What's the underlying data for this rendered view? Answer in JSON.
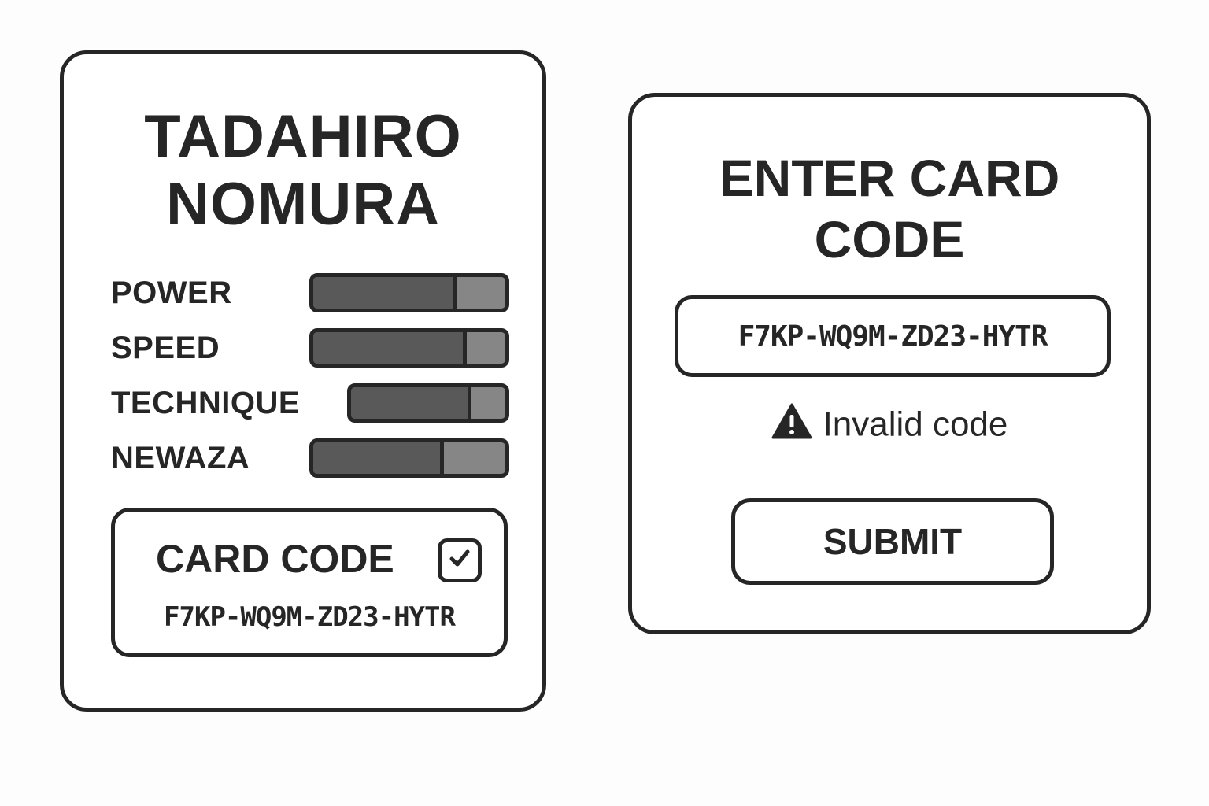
{
  "player_card": {
    "name_line1": "TADAHIRO",
    "name_line2": "NOMURA",
    "stats": [
      {
        "label": "POWER",
        "level": 0.75
      },
      {
        "label": "SPEED",
        "level": 0.8
      },
      {
        "label": "TECHNIQUE",
        "level": 0.78
      },
      {
        "label": "NEWAZA",
        "level": 0.68
      }
    ],
    "code_box": {
      "title": "CARD CODE",
      "value": "F7KP-WQ9M-ZD23-HYTR",
      "icon": "checkbox-checked-icon"
    }
  },
  "entry_dialog": {
    "title_line1": "ENTER CARD",
    "title_line2": "CODE",
    "input_value": "F7KP-WQ9M-ZD23-HYTR",
    "error_icon": "warning-icon",
    "error_text": "Invalid code",
    "submit_label": "SUBMIT"
  },
  "colors": {
    "ink": "#262626",
    "bar_fill": "#595959",
    "bar_track": "#868686",
    "background": "#fdfdfd"
  }
}
